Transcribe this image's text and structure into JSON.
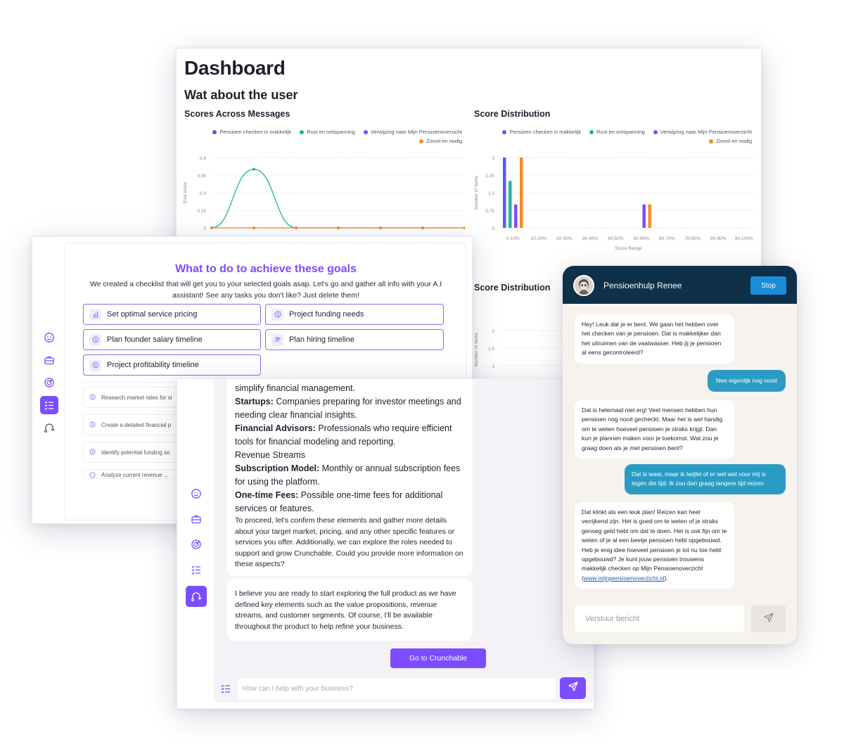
{
  "dashboard": {
    "title": "Dashboard",
    "section": "Wat about the user",
    "legend": [
      {
        "label": "Pensioen checken is makkelijk",
        "color": "#5b5ce6"
      },
      {
        "label": "Rust en ontspanning",
        "color": "#1fb59a"
      },
      {
        "label": "Verwijzing naar Mijn Pensioenoverzicht",
        "color": "#7c4dff"
      },
      {
        "label": "Zinvol en nodig",
        "color": "#f58a2a"
      }
    ]
  },
  "chart_data": [
    {
      "type": "line",
      "title": "Scores Across Messages",
      "ylabel": "Eval score",
      "ylim": [
        0,
        0.6
      ],
      "yticks": [
        "0.6",
        "0.45",
        "0.3",
        "0.15",
        "0"
      ],
      "x": [
        0,
        1,
        2,
        3,
        4,
        5,
        6
      ],
      "series": [
        {
          "name": "Rust en ontspanning",
          "values": [
            0,
            0.5,
            0,
            0,
            0,
            0,
            0
          ]
        },
        {
          "name": "Zinvol en nodig",
          "values": [
            0,
            0,
            0,
            0,
            0,
            0,
            0
          ]
        }
      ],
      "legend": "top-right",
      "grid": true
    },
    {
      "type": "bar",
      "title": "Score Distribution",
      "xlabel": "Score Range",
      "ylabel": "Number of Items",
      "ylim": [
        0,
        3
      ],
      "yticks": [
        "3",
        "2.25",
        "1.5",
        "0.75",
        "0"
      ],
      "categories": [
        "0-10%",
        "10-20%",
        "20-30%",
        "30-40%",
        "40-50%",
        "50-60%",
        "60-70%",
        "70-80%",
        "80-90%",
        "90-100%"
      ],
      "series": [
        {
          "name": "Pensioen checken is makkelijk",
          "values": [
            3,
            0,
            0,
            0,
            0,
            0,
            0,
            0,
            0,
            0
          ]
        },
        {
          "name": "Rust en ontspanning",
          "values": [
            2,
            0,
            0,
            0,
            0,
            0,
            0,
            0,
            0,
            0
          ]
        },
        {
          "name": "Verwijzing naar Mijn Pensioenoverzicht",
          "values": [
            1,
            0,
            0,
            0,
            0,
            1,
            0,
            0,
            0,
            0
          ]
        },
        {
          "name": "Zinvol en nodig",
          "values": [
            3,
            0,
            0,
            0,
            0,
            1,
            0,
            0,
            0,
            0
          ]
        }
      ],
      "legend": "top-right",
      "grid": true
    },
    {
      "type": "bar",
      "title": "Score Distribution",
      "ylabel": "Number of Items",
      "yticks": [
        "2",
        "1.5",
        "1"
      ]
    }
  ],
  "goals": {
    "title": "What to do to achieve these goals",
    "subtitle": "We created a checklist that will get you to your selected goals asap. Let's go and gather all info with your A.I assistant! See any tasks you don't like? Just delete them!",
    "items": [
      {
        "label": "Set optimal service pricing"
      },
      {
        "label": "Project funding needs"
      },
      {
        "label": "Plan founder salary timeline"
      },
      {
        "label": "Plan hiring timeline"
      },
      {
        "label": "Project profitability timeline"
      }
    ],
    "tasks": [
      {
        "label": "Research market rates for si"
      },
      {
        "label": "Create a detailed financial p"
      },
      {
        "label": "Identify potential funding so"
      },
      {
        "label": "Analyze current revenue ..."
      }
    ]
  },
  "chat": {
    "intro": "simplify financial management.",
    "lines": [
      {
        "bold": "Startups:",
        "text": " Companies preparing for investor meetings and needing clear financial insights."
      },
      {
        "bold": "Financial Advisors:",
        "text": " Professionals who require efficient tools for financial modeling and reporting."
      },
      {
        "bold": "",
        "text": "Revenue Streams"
      },
      {
        "bold": "Subscription Model:",
        "text": " Monthly or annual subscription fees for using the platform."
      },
      {
        "bold": "One-time Fees:",
        "text": " Possible one-time fees for additional services or features."
      }
    ],
    "proceed": "To proceed, let's confirm these elements and gather more details about your target market, pricing, and any other specific features or services you offer. Additionally, we can explore the roles needed to support and grow Crunchable. Could you provide more information on these aspects?",
    "ready": "I believe you are ready to start exploring the full product as we have defined key elements such as the value propositions, revenue streams, and customer segments. Of course, I'll be available throughout the product to help refine your business.",
    "cta": "Go to Crunchable",
    "input_placeholder": "How can I help with your business?"
  },
  "renee": {
    "name": "Pensioenhulp Renee",
    "stop": "Stop",
    "m1": "Hey! Leuk dat je er bent. We gaan het hebben over het checken van je pensioen. Dat is makkelijker dan het uitruimen van de vaatwasser. Heb jij je pensioen al eens gecontroleerd?",
    "m2": "Nee eigenlijk nog nooit",
    "m3": "Dat is helemaal niet erg! Veel mensen hebben hun pensioen nog nooit gecheckt. Maar het is wel handig om te weten hoeveel pensioen je straks krijgt. Dan kun je plannen maken voor je toekomst. Wat zou je graag doen als je met pensioen bent?",
    "m4": "Dat is waar, maar ik twijfel of er wel wat voor mij is tegen die tijd. Ik zou dan graag langere tijd reizen",
    "m5": "Dat klinkt als een leuk plan! Reizen kan heel verrijkend zijn. Het is goed om te weten of je straks genoeg geld hebt om dat te doen. Het is ook fijn om te weten of je al een beetje pensioen hebt opgebouwd. Heb je enig idee hoeveel pensioen je tot nu toe hebt opgebouwd? Je kunt jouw pensioen trouwens makkelijk checken op Mijn Pensioenoverzicht (",
    "m5_link": "www.mijnpensioenoverzicht.nl",
    "m5_end": ").",
    "input_placeholder": "Verstuur bericht"
  }
}
